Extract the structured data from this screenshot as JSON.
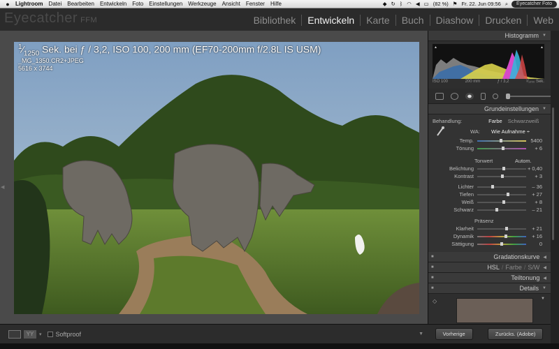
{
  "menubar": {
    "app_name": "Lightroom",
    "items": [
      "Datei",
      "Bearbeiten",
      "Entwickeln",
      "Foto",
      "Einstellungen",
      "Werkzeuge",
      "Ansicht",
      "Fenster",
      "Hilfe"
    ],
    "battery": "(82 %)",
    "datetime": "Fr. 22. Jun  09:56",
    "user": "Eyecatcher Foto"
  },
  "header": {
    "brand": "Eyecatcher",
    "brand_sub": "FFM",
    "modules": [
      "Bibliothek",
      "Entwickeln",
      "Karte",
      "Buch",
      "Diashow",
      "Drucken",
      "Web"
    ],
    "active_module": "Entwickeln"
  },
  "photo": {
    "exposure_num": "1",
    "exposure_den": "1250",
    "exposure_text": " Sek. bei ƒ / 3,2, ISO 100, 200 mm (EF70-200mm f/2.8L IS USM)",
    "filename": "_MG_1350.CR2+JPEG",
    "dimensions": "5616 x 3744"
  },
  "toolbar": {
    "softproof_label": "Softproof"
  },
  "histogram": {
    "title": "Histogramm",
    "iso": "ISO 100",
    "focal": "200 mm",
    "aperture": "ƒ / 3,2",
    "shutter": "¹⁄₁₂₅₀ Sek."
  },
  "basic": {
    "title": "Grundeinstellungen",
    "treatment_label": "Behandlung:",
    "treatment_color": "Farbe",
    "treatment_bw": "Schwarzweiß",
    "wb_label": "WA:",
    "wb_value": "Wie Aufnahme ÷",
    "temp": {
      "label": "Temp.",
      "value": "5400",
      "pos": 0.48
    },
    "tint": {
      "label": "Tönung",
      "value": "+ 6",
      "pos": 0.53
    },
    "tone_title": "Tonwert",
    "auto_label": "Autom.",
    "tone": [
      {
        "label": "Belichtung",
        "value": "+ 0,40",
        "pos": 0.54
      },
      {
        "label": "Kontrast",
        "value": "+ 3",
        "pos": 0.51
      }
    ],
    "tone2": [
      {
        "label": "Lichter",
        "value": "– 36",
        "pos": 0.32
      },
      {
        "label": "Tiefen",
        "value": "+ 27",
        "pos": 0.63
      },
      {
        "label": "Weiß",
        "value": "+ 8",
        "pos": 0.54
      },
      {
        "label": "Schwarz",
        "value": "– 21",
        "pos": 0.4
      }
    ],
    "presence_title": "Präsenz",
    "presence": [
      {
        "label": "Klarheit",
        "value": "+ 21",
        "pos": 0.6
      },
      {
        "label": "Dynamik",
        "value": "+ 16",
        "pos": 0.58
      },
      {
        "label": "Sättigung",
        "value": "0",
        "pos": 0.5
      }
    ]
  },
  "panels": {
    "tone_curve": "Gradationskurve",
    "hsl": "HSL",
    "hsl_color": "Farbe",
    "hsl_bw": "S/W",
    "split_toning": "Teiltonung",
    "details": "Details"
  },
  "panel_buttons": {
    "previous": "Vorherige",
    "reset": "Zurücks. (Adobe)"
  }
}
